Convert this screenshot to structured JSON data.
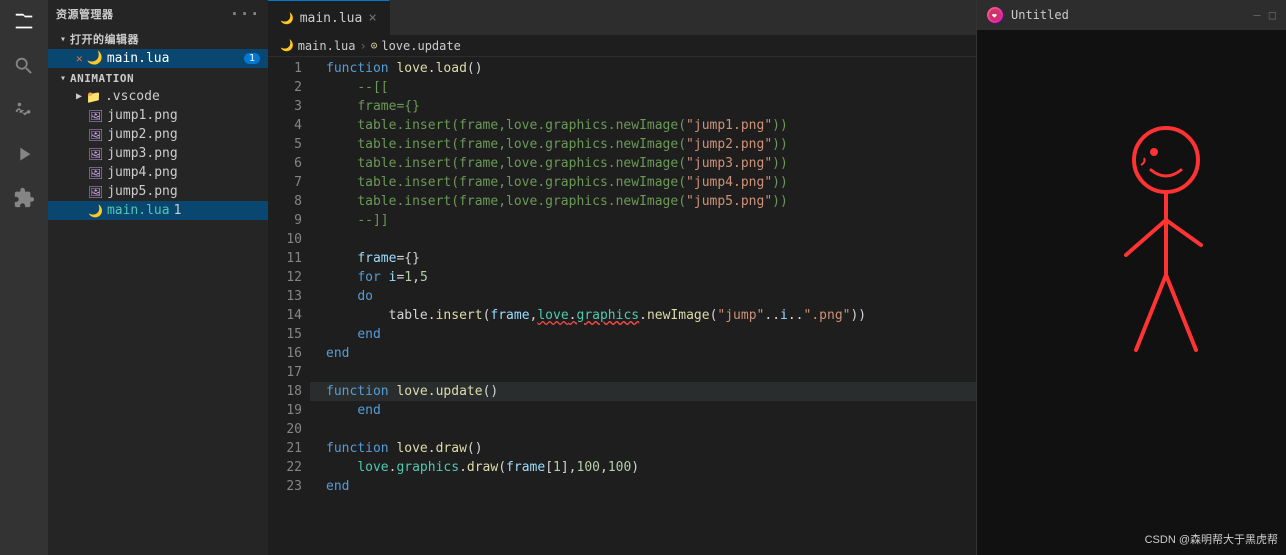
{
  "activityBar": {
    "icons": [
      {
        "name": "files-icon",
        "glyph": "⧉",
        "active": false
      },
      {
        "name": "search-icon",
        "glyph": "⌕",
        "active": false
      },
      {
        "name": "source-control-icon",
        "glyph": "⎇",
        "active": false
      },
      {
        "name": "debug-icon",
        "glyph": "▷",
        "active": false
      },
      {
        "name": "extensions-icon",
        "glyph": "⊞",
        "active": false
      }
    ]
  },
  "sidebar": {
    "header": "资源管理器",
    "openEditors": {
      "label": "打开的编辑器",
      "items": [
        {
          "name": "main.lua",
          "badge": "1",
          "active": true,
          "icon": "lua"
        }
      ]
    },
    "explorer": {
      "label": "ANIMATION",
      "items": [
        {
          "name": ".vscode",
          "type": "folder",
          "indent": 1
        },
        {
          "name": "jump1.png",
          "type": "png",
          "indent": 2
        },
        {
          "name": "jump2.png",
          "type": "png",
          "indent": 2
        },
        {
          "name": "jump3.png",
          "type": "png",
          "indent": 2
        },
        {
          "name": "jump4.png",
          "type": "png",
          "indent": 2
        },
        {
          "name": "jump5.png",
          "type": "png",
          "indent": 2
        },
        {
          "name": "main.lua",
          "type": "lua",
          "indent": 2,
          "badge": "1"
        }
      ]
    }
  },
  "editor": {
    "tab": {
      "label": "main.lua",
      "modified": false
    },
    "breadcrumb": {
      "path": [
        "main.lua",
        "love.update"
      ]
    },
    "lines": [
      {
        "num": 1,
        "content": "function love.load()"
      },
      {
        "num": 2,
        "content": "    --[["
      },
      {
        "num": 3,
        "content": "    frame={}"
      },
      {
        "num": 4,
        "content": "    table.insert(frame,love.graphics.newImage(\"jump1.png\"))"
      },
      {
        "num": 5,
        "content": "    table.insert(frame,love.graphics.newImage(\"jump2.png\"))"
      },
      {
        "num": 6,
        "content": "    table.insert(frame,love.graphics.newImage(\"jump3.png\"))"
      },
      {
        "num": 7,
        "content": "    table.insert(frame,love.graphics.newImage(\"jump4.png\"))"
      },
      {
        "num": 8,
        "content": "    table.insert(frame,love.graphics.newImage(\"jump5.png\"))"
      },
      {
        "num": 9,
        "content": "    --]]"
      },
      {
        "num": 10,
        "content": ""
      },
      {
        "num": 11,
        "content": "    frame={}"
      },
      {
        "num": 12,
        "content": "    for i=1,5"
      },
      {
        "num": 13,
        "content": "    do"
      },
      {
        "num": 14,
        "content": "        table.insert(frame,love.graphics.newImage(\"jump\"..i..\".png\"))"
      },
      {
        "num": 15,
        "content": "    end"
      },
      {
        "num": 16,
        "content": "end"
      },
      {
        "num": 17,
        "content": ""
      },
      {
        "num": 18,
        "content": "function love.update()"
      },
      {
        "num": 19,
        "content": "    end"
      },
      {
        "num": 20,
        "content": ""
      },
      {
        "num": 21,
        "content": "function love.draw()"
      },
      {
        "num": 22,
        "content": "    love.graphics.draw(frame[1],100,100)"
      },
      {
        "num": 23,
        "content": "end"
      }
    ]
  },
  "preview": {
    "title": "Untitled",
    "icon": "❤",
    "watermark": "CSDN @森明帮大于黑虎帮"
  }
}
